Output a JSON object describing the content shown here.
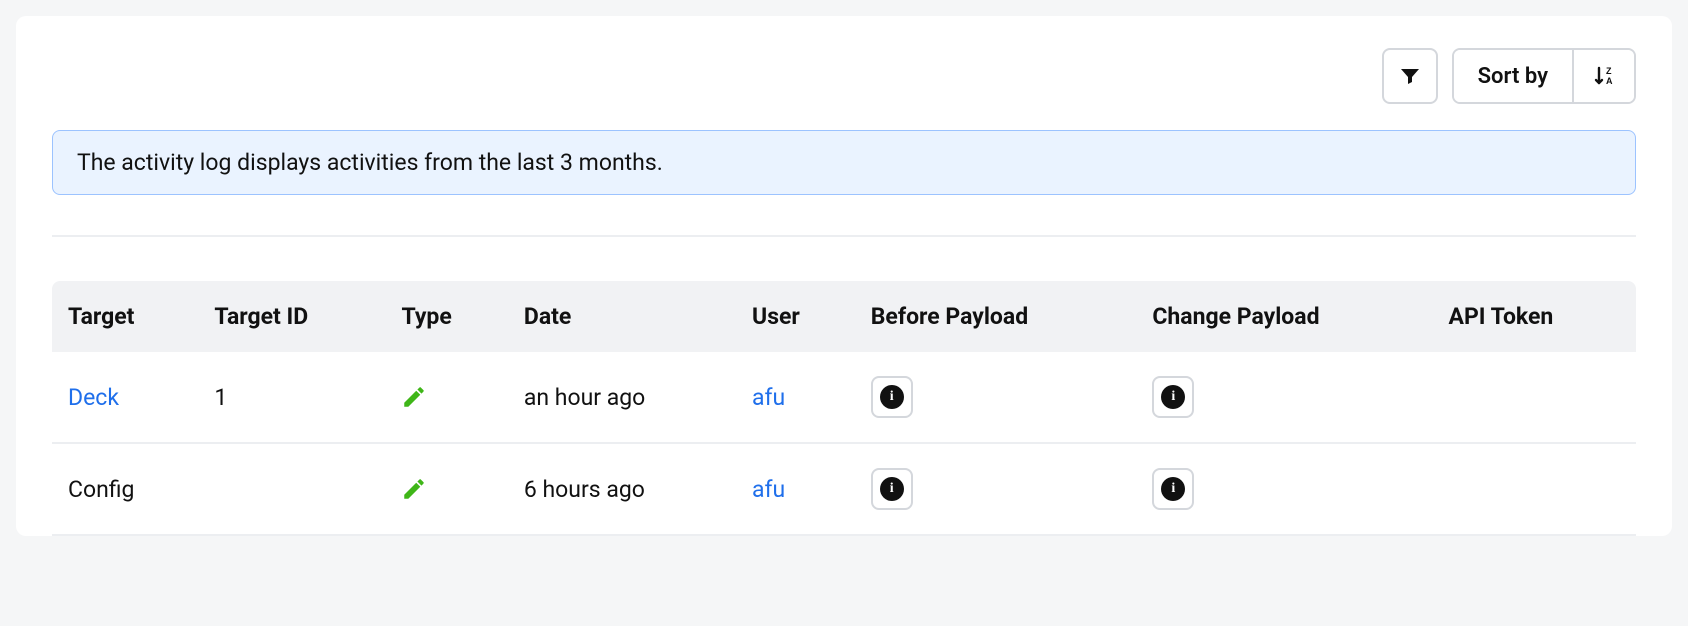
{
  "toolbar": {
    "filter_icon": "filter-icon",
    "sort_label": "Sort by",
    "sort_direction_icon": "sort-za-icon"
  },
  "alert": {
    "text": "The activity log displays activities from the last 3 months."
  },
  "table": {
    "headers": {
      "target": "Target",
      "target_id": "Target ID",
      "type": "Type",
      "date": "Date",
      "user": "User",
      "before_payload": "Before Payload",
      "change_payload": "Change Payload",
      "api_token": "API Token"
    },
    "rows": [
      {
        "target": "Deck",
        "target_is_link": true,
        "target_id": "1",
        "type_icon": "pencil-icon",
        "date": "an hour ago",
        "user": "afu",
        "user_is_link": true,
        "before_payload_info": true,
        "change_payload_info": true,
        "api_token": ""
      },
      {
        "target": "Config",
        "target_is_link": false,
        "target_id": "",
        "type_icon": "pencil-icon",
        "date": "6 hours ago",
        "user": "afu",
        "user_is_link": true,
        "before_payload_info": true,
        "change_payload_info": true,
        "api_token": ""
      }
    ]
  }
}
